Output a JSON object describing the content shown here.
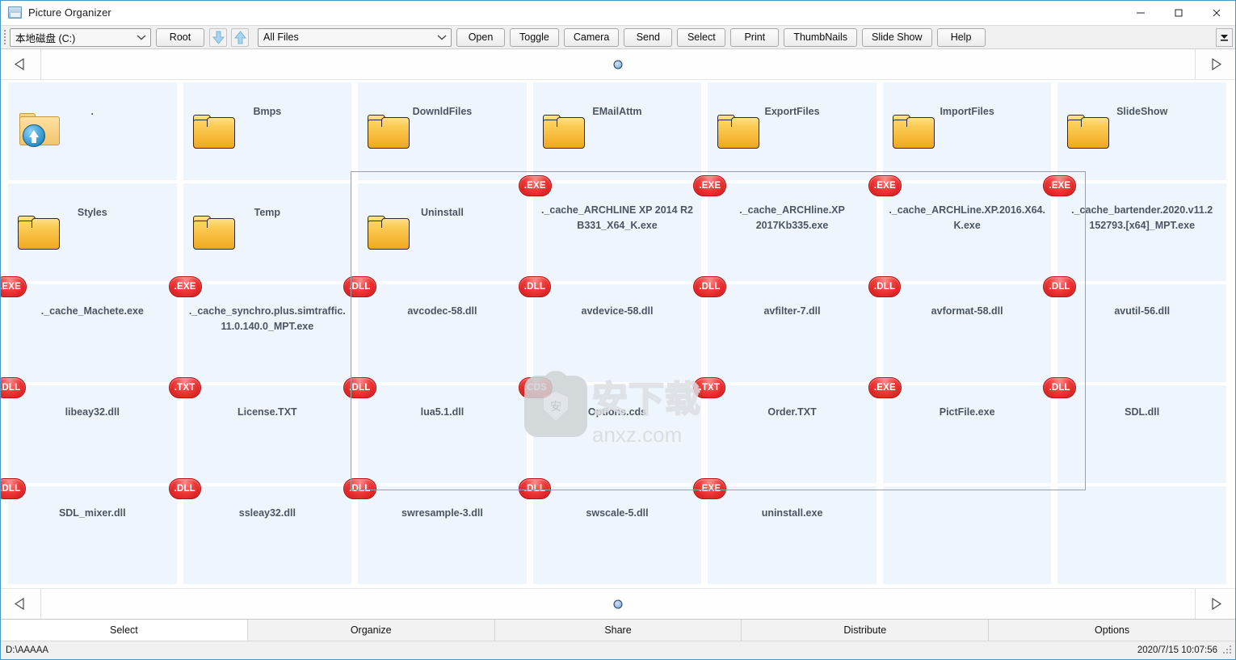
{
  "window": {
    "title": "Picture Organizer",
    "icon": "picture-organizer-icon",
    "minimize": "—",
    "maximize": "□",
    "close": "✕"
  },
  "toolbar": {
    "drive_combo_value": "本地磁盘 (C:)",
    "root_label": "Root",
    "down_label": "↓",
    "up_label": "↑",
    "filter_combo_value": "All Files",
    "buttons": [
      "Open",
      "Toggle",
      "Camera",
      "Send",
      "Select",
      "Print",
      "ThumbNails",
      "Slide Show",
      "Help"
    ],
    "overflow_label": "▼"
  },
  "scroll": {
    "left_arrow": "◁",
    "right_arrow": "▷",
    "thumb": "scroll-thumb"
  },
  "watermark": {
    "cn_text": "安下载",
    "url_text": "anxz.com",
    "shield_char": "安"
  },
  "items": [
    {
      "name": ".",
      "type": "parent",
      "badge": ""
    },
    {
      "name": "Bmps",
      "type": "folder",
      "badge": ""
    },
    {
      "name": "DownldFiles",
      "type": "folder",
      "badge": ""
    },
    {
      "name": "EMailAttm",
      "type": "folder",
      "badge": ""
    },
    {
      "name": "ExportFiles",
      "type": "folder",
      "badge": ""
    },
    {
      "name": "ImportFiles",
      "type": "folder",
      "badge": ""
    },
    {
      "name": "SlideShow",
      "type": "folder",
      "badge": ""
    },
    {
      "name": "Styles",
      "type": "folder",
      "badge": ""
    },
    {
      "name": "Temp",
      "type": "folder",
      "badge": ""
    },
    {
      "name": "Uninstall",
      "type": "folder",
      "badge": ""
    },
    {
      "name": "._cache_ARCHLINE XP 2014 R2 B331_X64_K.exe",
      "type": "file",
      "badge": ".EXE"
    },
    {
      "name": "._cache_ARCHline.XP 2017Kb335.exe",
      "type": "file",
      "badge": ".EXE"
    },
    {
      "name": "._cache_ARCHLine.XP.2016.X64.K.exe",
      "type": "file",
      "badge": ".EXE"
    },
    {
      "name": "._cache_bartender.2020.v11.2 152793.[x64]_MPT.exe",
      "type": "file",
      "badge": ".EXE"
    },
    {
      "name": "._cache_Machete.exe",
      "type": "file",
      "badge": ".EXE"
    },
    {
      "name": "._cache_synchro.plus.simtraffic.11.0.140.0_MPT.exe",
      "type": "file",
      "badge": ".EXE"
    },
    {
      "name": "avcodec-58.dll",
      "type": "file",
      "badge": ".DLL"
    },
    {
      "name": "avdevice-58.dll",
      "type": "file",
      "badge": ".DLL"
    },
    {
      "name": "avfilter-7.dll",
      "type": "file",
      "badge": ".DLL"
    },
    {
      "name": "avformat-58.dll",
      "type": "file",
      "badge": ".DLL"
    },
    {
      "name": "avutil-56.dll",
      "type": "file",
      "badge": ".DLL"
    },
    {
      "name": "libeay32.dll",
      "type": "file",
      "badge": ".DLL"
    },
    {
      "name": "License.TXT",
      "type": "file",
      "badge": ".TXT"
    },
    {
      "name": "lua5.1.dll",
      "type": "file",
      "badge": ".DLL"
    },
    {
      "name": "Options.cds",
      "type": "file",
      "badge": ".CDS"
    },
    {
      "name": "Order.TXT",
      "type": "file",
      "badge": ".TXT"
    },
    {
      "name": "PictFile.exe",
      "type": "file",
      "badge": ".EXE"
    },
    {
      "name": "SDL.dll",
      "type": "file",
      "badge": ".DLL"
    },
    {
      "name": "SDL_mixer.dll",
      "type": "file",
      "badge": ".DLL"
    },
    {
      "name": "ssleay32.dll",
      "type": "file",
      "badge": ".DLL"
    },
    {
      "name": "swresample-3.dll",
      "type": "file",
      "badge": ".DLL"
    },
    {
      "name": "swscale-5.dll",
      "type": "file",
      "badge": ".DLL"
    },
    {
      "name": "uninstall.exe",
      "type": "file",
      "badge": ".EXE"
    },
    {
      "name": "",
      "type": "empty",
      "badge": ""
    },
    {
      "name": "",
      "type": "empty",
      "badge": ""
    }
  ],
  "tabs": [
    {
      "label": "Select",
      "active": true
    },
    {
      "label": "Organize",
      "active": false
    },
    {
      "label": "Share",
      "active": false
    },
    {
      "label": "Distribute",
      "active": false
    },
    {
      "label": "Options",
      "active": false
    }
  ],
  "status": {
    "path": "D:\\AAAAA",
    "timestamp": "2020/7/15 10:07:56"
  },
  "colors": {
    "window_border": "#4a96c4",
    "cell_bg": "#eff5fd",
    "badge_red": "#e02020",
    "label_text": "#4b5563",
    "folder_yellow": "#f7c444"
  }
}
